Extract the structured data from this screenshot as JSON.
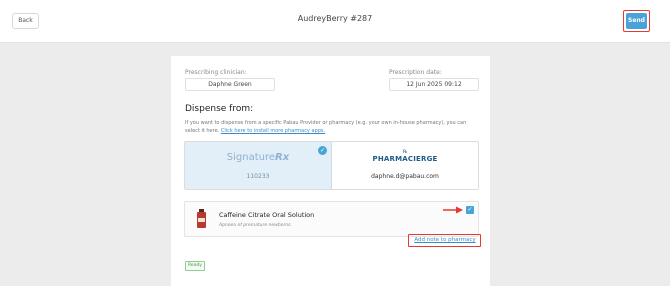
{
  "header": {
    "back_label": "Back",
    "title": "AudreyBerry #287",
    "send_label": "Send",
    "send_color": "#4aa3d8"
  },
  "form": {
    "clinician_label": "Prescribing clinician:",
    "clinician_value": "Daphne Green",
    "date_label": "Prescription date:",
    "date_value": "12 Jun 2025 09:12",
    "dispense_heading": "Dispense from:",
    "help_text": "If you want to dispense from a specific Pabau Provider or pharmacy (e.g. your own in-house pharmacy), you can select it here.",
    "help_link": "Click here to install more pharmacy apps."
  },
  "providers": [
    {
      "name": "Signature",
      "logo_suffix": "Rx",
      "code": "110233",
      "selected": true,
      "icon": "check-icon"
    },
    {
      "name": "PHARMACIERGE",
      "logo_mark": "℞",
      "email": "daphne.d@pabau.com",
      "selected": false
    }
  ],
  "product": {
    "name": "Caffeine Citrate Oral Solution",
    "description": "Apnoea of premature newborns.",
    "checked": true,
    "icon": "medicine-bottle-icon"
  },
  "actions": {
    "add_note_label": "Add note to pharmacy"
  },
  "status": {
    "label": "Ready",
    "color": "#3e9a3e"
  },
  "colors": {
    "accent": "#4aa3d8",
    "highlight": "#e53935"
  }
}
